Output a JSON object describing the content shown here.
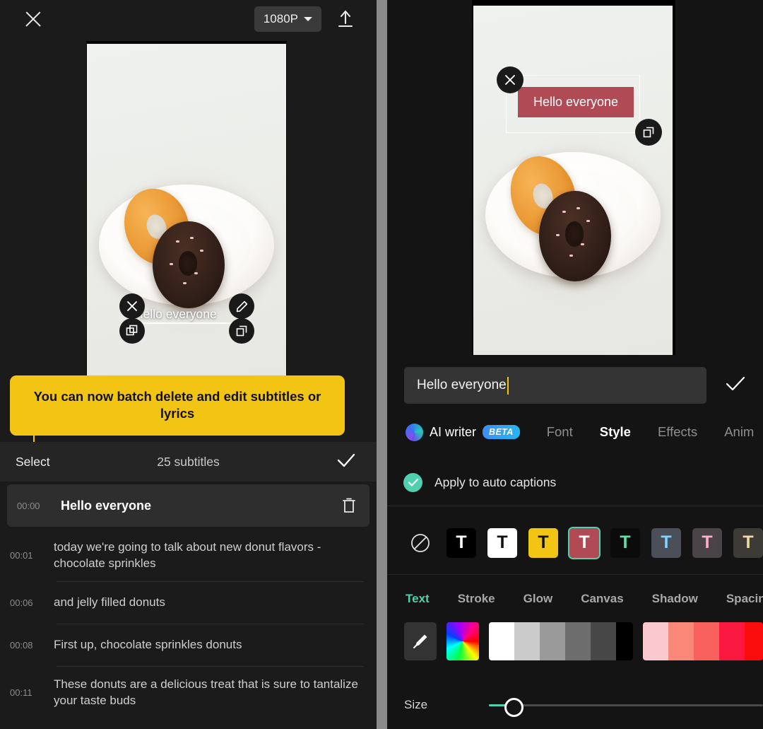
{
  "left": {
    "topbar": {
      "close_icon": "close-icon",
      "resolution": "1080P",
      "upload_icon": "upload-icon"
    },
    "preview": {
      "overlay_text": "Hello everyone",
      "handles": [
        "close-icon",
        "copy-icon",
        "edit-pencil-icon",
        "resize-icon"
      ]
    },
    "tooltip": {
      "text": "You can now batch delete and edit subtitles or lyrics"
    },
    "subtitle_header": {
      "select_label": "Select",
      "count_label": "25 subtitles",
      "confirm_icon": "check-icon"
    },
    "subtitles": [
      {
        "time": "00:00",
        "text": "Hello everyone",
        "active": true
      },
      {
        "time": "00:01",
        "text": "today we're going to talk about new donut flavors - chocolate sprinkles",
        "active": false
      },
      {
        "time": "00:06",
        "text": "and jelly filled donuts",
        "active": false
      },
      {
        "time": "00:08",
        "text": "First up, chocolate sprinkles donuts",
        "active": false
      },
      {
        "time": "00:11",
        "text": "These donuts are a delicious treat that is sure to tantalize your taste buds",
        "active": false
      }
    ]
  },
  "right": {
    "preview": {
      "overlay_text": "Hello everyone",
      "overlay_bg_color": "#b04a55",
      "handles": [
        "close-icon",
        "resize-icon"
      ]
    },
    "text_input": {
      "value": "Hello everyone",
      "confirm_icon": "check-icon"
    },
    "tabs": [
      {
        "label": "AI writer",
        "badge": "BETA",
        "icon": "ai-orb-icon",
        "active": false
      },
      {
        "label": "Font",
        "active": false
      },
      {
        "label": "Style",
        "active": true
      },
      {
        "label": "Effects",
        "active": false
      },
      {
        "label": "Anim",
        "active": false
      }
    ],
    "apply_auto_captions": {
      "label": "Apply to auto captions",
      "checked": true,
      "check_color": "#4fd1b0"
    },
    "presets": [
      {
        "name": "none",
        "glyph": "⊘",
        "bg": "none",
        "fg": "#e0e0e0",
        "selected": false
      },
      {
        "name": "black-on-black",
        "glyph": "T",
        "bg": "#000000",
        "fg": "#ffffff",
        "selected": false
      },
      {
        "name": "black-on-white",
        "glyph": "T",
        "bg": "#ffffff",
        "fg": "#111111",
        "selected": false
      },
      {
        "name": "black-on-yellow",
        "glyph": "T",
        "bg": "#f2c413",
        "fg": "#111111",
        "selected": false
      },
      {
        "name": "white-on-red",
        "glyph": "T",
        "bg": "#b04a55",
        "fg": "#ffffff",
        "selected": true
      },
      {
        "name": "green-on-black",
        "glyph": "T",
        "bg": "#0b0b0b",
        "fg": "#5fe0a8",
        "selected": false
      },
      {
        "name": "blue-on-gray",
        "glyph": "T",
        "bg": "#4a4f58",
        "fg": "#7fd3ff",
        "selected": false
      },
      {
        "name": "pink-on-gray",
        "glyph": "T",
        "bg": "#4a4449",
        "fg": "#ffb0c8",
        "selected": false
      },
      {
        "name": "tan-on-gray",
        "glyph": "T",
        "bg": "#3d3b36",
        "fg": "#f0d9a8",
        "selected": false
      }
    ],
    "subtabs": [
      {
        "label": "Text",
        "active": true
      },
      {
        "label": "Stroke",
        "active": false
      },
      {
        "label": "Glow",
        "active": false
      },
      {
        "label": "Canvas",
        "active": false
      },
      {
        "label": "Shadow",
        "active": false
      },
      {
        "label": "Spacing",
        "active": false
      }
    ],
    "color_tools": {
      "eyedropper_icon": "eyedropper-icon",
      "rainbow_icon": "color-wheel-icon"
    },
    "color_swatches_gray": [
      "#ffffff",
      "#cbcbcb",
      "#9a9a9a",
      "#6d6d6d",
      "#474747",
      "#000000"
    ],
    "color_swatches_red": [
      "#fac8ce",
      "#fa8878",
      "#f9615c",
      "#fa1740",
      "#fb0d0d"
    ],
    "size": {
      "label": "Size",
      "value_pct": 9,
      "track_color": "#4a4a4a",
      "fill_color": "#4fd1b0"
    }
  }
}
